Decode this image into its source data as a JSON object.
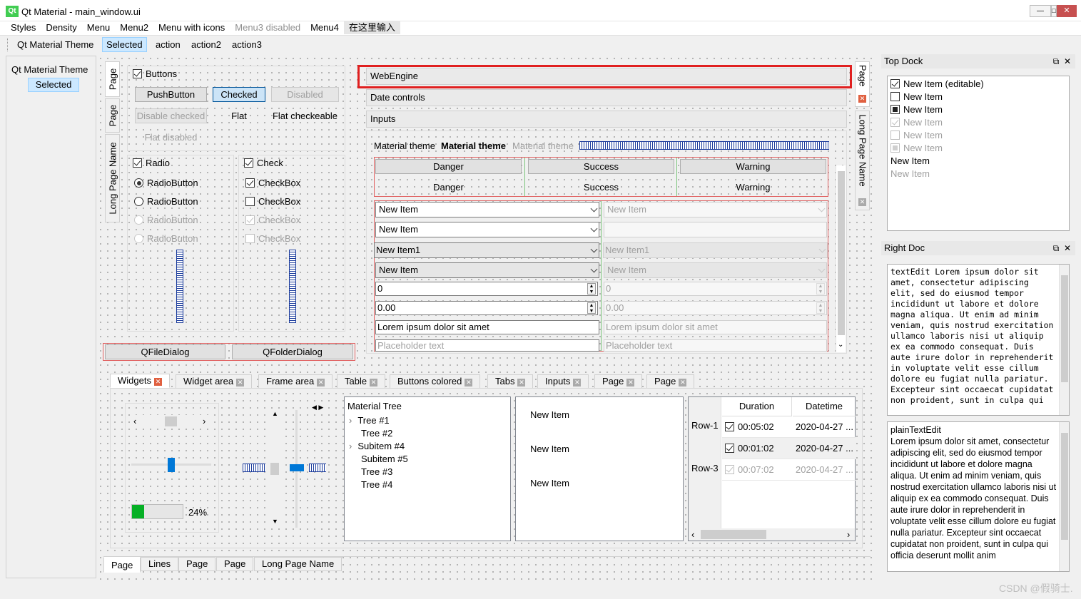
{
  "window": {
    "title": "Qt Material - main_window.ui",
    "logo": "Qt",
    "min": "—",
    "max": "□",
    "close": "✕"
  },
  "menu": [
    "Styles",
    "Density",
    "Menu",
    "Menu2",
    "Menu with icons",
    "Menu3 disabled",
    "Menu4",
    "在这里输入"
  ],
  "toolbar": {
    "title": "Qt Material Theme",
    "items": [
      "Selected",
      "action",
      "action2",
      "action3"
    ]
  },
  "left_panel": {
    "title": "Qt Material Theme",
    "selected": "Selected"
  },
  "vtabs_left": [
    "Page",
    "Page",
    "Long Page Name"
  ],
  "buttons": {
    "group": "Buttons",
    "push": "PushButton",
    "checked": "Checked",
    "disabled": "Disabled",
    "disable_checked": "Disable checked",
    "flat": "Flat",
    "flat_checkable": "Flat checkeable",
    "flat_disabled": "Flat disabled"
  },
  "radio": {
    "group": "Radio",
    "items": [
      "RadioButton",
      "RadioButton",
      "RadioButton",
      "RadioButton"
    ]
  },
  "check": {
    "group": "Check",
    "items": [
      "CheckBox",
      "CheckBox",
      "CheckBox",
      "CheckBox"
    ]
  },
  "dialogs": {
    "file": "QFileDialog",
    "folder": "QFolderDialog"
  },
  "toolbox": {
    "items": [
      "WebEngine",
      "Date controls",
      "Inputs"
    ]
  },
  "labels": {
    "l1": "Material theme",
    "l2": "Material theme",
    "l3": "Material theme"
  },
  "colored": {
    "danger": "Danger",
    "success": "Success",
    "warning": "Warning"
  },
  "inputs": {
    "combo1": "New Item",
    "combo2": "New Item",
    "combo3": "New Item1",
    "combo4": "New Item",
    "spin": "0",
    "dspin": "0.00",
    "line": "Lorem ipsum dolor sit amet",
    "placeholder": "Placeholder text",
    "d_combo1": "New Item",
    "d_combo3": "New Item1",
    "d_combo4": "New Item",
    "d_spin": "0",
    "d_dspin": "0.00",
    "d_line": "Lorem ipsum dolor sit amet",
    "d_placeholder": "Placeholder text"
  },
  "vtabs_right": [
    "Page",
    "Long Page Name"
  ],
  "bottom_tabs": [
    "Widgets",
    "Widget area",
    "Frame area",
    "Table",
    "Buttons colored",
    "Tabs",
    "Inputs",
    "Page",
    "Page"
  ],
  "progress": {
    "value": 0.24,
    "label": "24%"
  },
  "tree": {
    "header": "Material Tree",
    "items": [
      "Tree #1",
      "Tree #2",
      "Subitem #4",
      "Subitem #5",
      "Tree #3",
      "Tree #4"
    ]
  },
  "list": [
    "New Item",
    "New Item",
    "New Item"
  ],
  "table": {
    "headers": [
      "Duration",
      "Datetime"
    ],
    "rows": [
      {
        "h": "Row-1",
        "d": "00:05:02",
        "t": "2020-04-27 ..."
      },
      {
        "h": "",
        "d": "00:01:02",
        "t": "2020-04-27 ..."
      },
      {
        "h": "Row-3",
        "d": "00:07:02",
        "t": "2020-04-27 ..."
      }
    ]
  },
  "bottom_page_tabs": [
    "Page",
    "Lines",
    "Page",
    "Page",
    "Long Page Name"
  ],
  "top_dock": {
    "title": "Top Dock",
    "items": [
      "New Item (editable)",
      "New Item",
      "New Item",
      "New Item",
      "New Item",
      "New Item",
      "New Item",
      "New Item"
    ]
  },
  "right_dock": {
    "title": "Right Doc",
    "textedit": "textEdit Lorem ipsum dolor sit amet, consectetur adipiscing elit, sed do eiusmod tempor incididunt ut labore et dolore magna aliqua. Ut enim ad minim veniam, quis nostrud exercitation ullamco laboris nisi ut aliquip ex ea commodo consequat. Duis aute irure dolor in reprehenderit in voluptate velit esse cillum dolore eu fugiat nulla pariatur. Excepteur sint occaecat cupidatat non proident, sunt in culpa qui",
    "plaintext": "plainTextEdit\nLorem ipsum dolor sit amet, consectetur adipiscing elit, sed do eiusmod tempor incididunt ut labore et dolore magna aliqua. Ut enim ad minim veniam, quis nostrud exercitation ullamco laboris nisi ut aliquip ex ea commodo consequat. Duis aute irure dolor in reprehenderit in voluptate velit esse cillum dolore eu fugiat nulla pariatur. Excepteur sint occaecat cupidatat non proident, sunt in culpa qui officia deserunt mollit anim"
  },
  "watermark": "CSDN @假骑士.",
  "colors": {
    "highlight": "#e02020",
    "selected_bg": "#cce8ff",
    "accent": "#0078d7"
  }
}
